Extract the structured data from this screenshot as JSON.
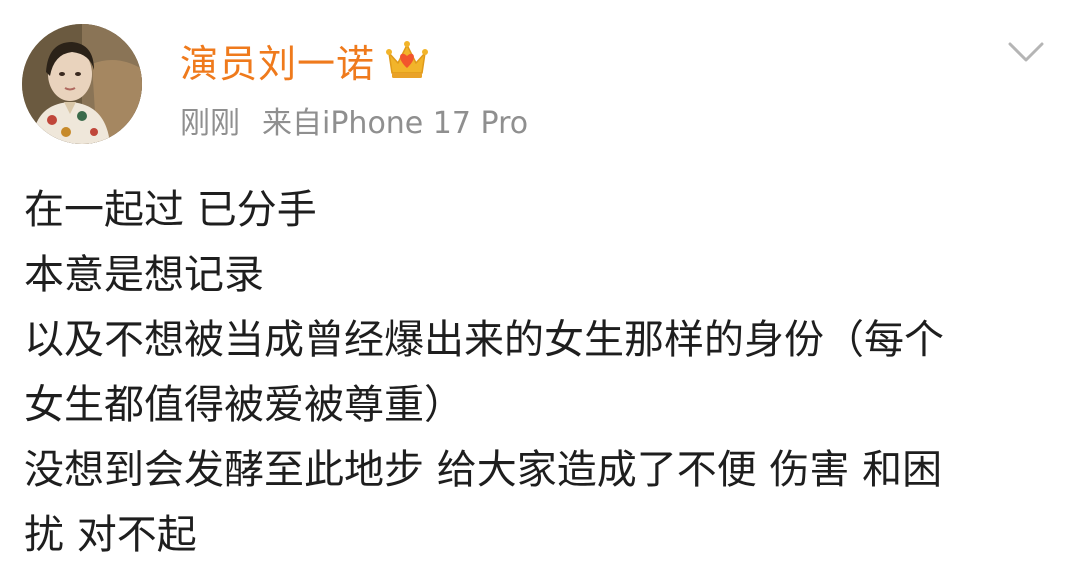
{
  "post": {
    "author": {
      "name": "演员刘一诺",
      "avatar_icon": "avatar-photo",
      "badge_icon": "crown-icon",
      "name_color": "#ef7a1c"
    },
    "meta": {
      "time": "刚刚",
      "source": "来自iPhone 17 Pro"
    },
    "menu_icon": "chevron-down-icon",
    "content_lines": [
      "在一起过 已分手",
      "本意是想记录",
      "以及不想被当成曾经爆出来的女生那样的身份（每个",
      "女生都值得被爱被尊重）",
      "没想到会发酵至此地步 给大家造成了不便 伤害 和困",
      "扰 对不起"
    ]
  }
}
